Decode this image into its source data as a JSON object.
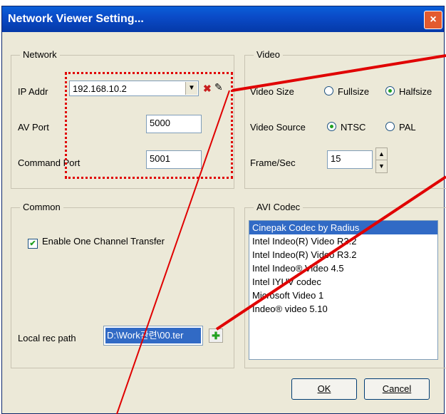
{
  "window": {
    "title": "Network Viewer Setting...",
    "close_glyph": "×"
  },
  "network": {
    "group_label": "Network",
    "ip_label": "IP Addr",
    "ip_value": "192.168.10.2",
    "av_port_label": "AV Port",
    "av_port_value": "5000",
    "command_port_label": "Command Port",
    "command_port_value": "5001",
    "icons": [
      "delete-icon",
      "edit-icon"
    ]
  },
  "video": {
    "group_label": "Video",
    "size_label": "Video Size",
    "size_options": [
      "Fullsize",
      "Halfsize"
    ],
    "size_selected": "Halfsize",
    "source_label": "Video Source",
    "source_options": [
      "NTSC",
      "PAL"
    ],
    "source_selected": "NTSC",
    "fps_label": "Frame/Sec",
    "fps_value": "15"
  },
  "common": {
    "group_label": "Common",
    "enable_transfer_label": "Enable One Channel Transfer",
    "enable_transfer_checked": true,
    "rec_path_label": "Local rec path",
    "rec_path_value": "D:\\Work관련\\00.ter"
  },
  "avi_codec": {
    "group_label": "AVI Codec",
    "items": [
      "Cinepak Codec by Radius",
      "Intel Indeo(R) Video R3.2",
      "Intel Indeo(R) Video R3.2",
      "Intel Indeo® Video 4.5",
      "Intel IYUV codec",
      "Microsoft Video 1",
      "Indeo® video 5.10"
    ],
    "selected_index": 0
  },
  "buttons": {
    "ok": "OK",
    "cancel": "Cancel"
  },
  "colors": {
    "annotation": "#e00000",
    "titlebar": "#0a4bc8",
    "selection": "#316ac5"
  }
}
